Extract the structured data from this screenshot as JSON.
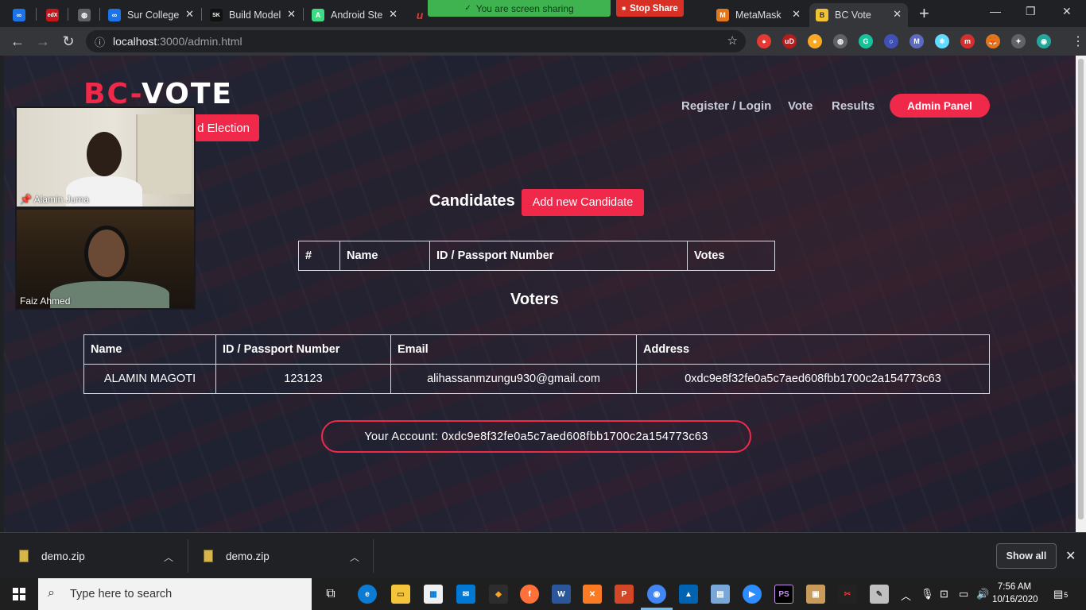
{
  "browser": {
    "tabs": [
      {
        "label": "",
        "fav_color": "#1a73e8",
        "fav_text": "∞"
      },
      {
        "label": "",
        "fav_color": "#c4161c",
        "fav_text": "edX"
      },
      {
        "label": "",
        "fav_color": "#5f6368",
        "fav_text": "◍"
      },
      {
        "label": "Sur College",
        "fav_color": "#1a73e8",
        "fav_text": "∞"
      },
      {
        "label": "Build Model",
        "fav_color": "#111111",
        "fav_text": "SK"
      },
      {
        "label": "Android Ste",
        "fav_color": "#3ddc84",
        "fav_text": "A"
      },
      {
        "label": "",
        "fav_color": "#e53935",
        "fav_text": "u"
      },
      {
        "label": "MetaMask",
        "fav_color": "#e2761b",
        "fav_text": "M"
      },
      {
        "label": "BC Vote",
        "fav_color": "#f1c232",
        "fav_text": "B"
      }
    ],
    "new_tab": "+",
    "url_host": "localhost",
    "url_path": ":3000/admin.html"
  },
  "share": {
    "banner": "You are screen sharing",
    "stop": "Stop Share"
  },
  "extensions": [
    {
      "color": "#e53935",
      "text": "●"
    },
    {
      "color": "#b71c1c",
      "text": "uD"
    },
    {
      "color": "#f9a825",
      "text": "●"
    },
    {
      "color": "#5f6368",
      "text": "◍"
    },
    {
      "color": "#15c39a",
      "text": "G"
    },
    {
      "color": "#3f51b5",
      "text": "○"
    },
    {
      "color": "#5c6bc0",
      "text": "M"
    },
    {
      "color": "#61dafb",
      "text": "⚛"
    },
    {
      "color": "#d32f2f",
      "text": "m"
    },
    {
      "color": "#e2761b",
      "text": "🦊"
    },
    {
      "color": "#5f6368",
      "text": "✦"
    },
    {
      "color": "#26a69a",
      "text": "◉"
    }
  ],
  "app": {
    "logo_red": "BC-",
    "logo_white": "VOTE",
    "nav": [
      "Register / Login",
      "Vote",
      "Results"
    ],
    "admin_panel": "Admin Panel",
    "end_election": "d Election"
  },
  "candidates": {
    "title": "Candidates",
    "add_button": "Add new Candidate",
    "columns": [
      "#",
      "Name",
      "ID / Passport Number",
      "Votes"
    ]
  },
  "voters": {
    "title": "Voters",
    "columns": [
      "Name",
      "ID / Passport Number",
      "Email",
      "Address"
    ],
    "rows": [
      [
        "ALAMIN MAGOTI",
        "123123",
        "alihassanmzungu930@gmail.com",
        "0xdc9e8f32fe0a5c7aed608fbb1700c2a154773c63"
      ]
    ]
  },
  "account": {
    "text": "Your Account: 0xdc9e8f32fe0a5c7aed608fbb1700c2a154773c63"
  },
  "video": {
    "participants": [
      "Alamin Juma",
      "Faiz Ahmed"
    ]
  },
  "downloads": {
    "files": [
      "demo.zip",
      "demo.zip"
    ],
    "show_all": "Show all"
  },
  "taskbar": {
    "search_placeholder": "Type here to search",
    "time": "7:56 AM",
    "date": "10/16/2020",
    "notifications": "5"
  }
}
